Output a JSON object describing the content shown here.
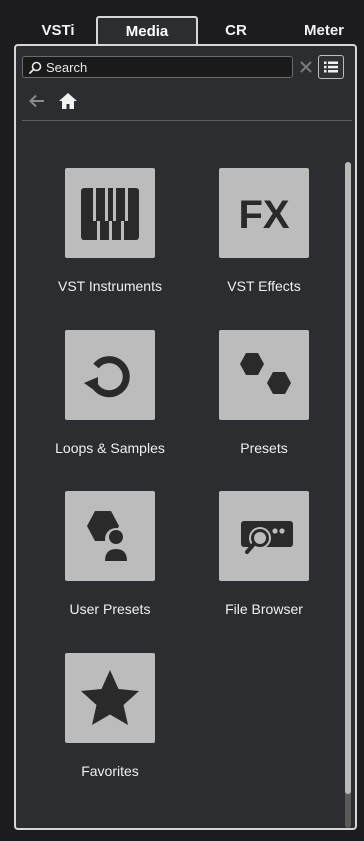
{
  "tabs": [
    {
      "label": "VSTi",
      "active": false
    },
    {
      "label": "Media",
      "active": true
    },
    {
      "label": "CR",
      "active": false
    },
    {
      "label": "Meter",
      "active": false
    }
  ],
  "search": {
    "placeholder": "Search"
  },
  "tiles": [
    {
      "label": "VST Instruments",
      "icon": "piano-keys-icon"
    },
    {
      "label": "VST Effects",
      "icon": "fx-icon"
    },
    {
      "label": "Loops & Samples",
      "icon": "loop-icon"
    },
    {
      "label": "Presets",
      "icon": "hexagons-icon"
    },
    {
      "label": "User Presets",
      "icon": "user-hexagon-icon"
    },
    {
      "label": "File Browser",
      "icon": "file-search-icon"
    },
    {
      "label": "Favorites",
      "icon": "star-icon"
    }
  ],
  "fx_icon_text": "FX",
  "colors": {
    "background": "#1c1c1e",
    "panel": "#2b2d30",
    "tile": "#bcbcbc",
    "glyph": "#2a2a2a",
    "border": "#d6d6d6"
  }
}
